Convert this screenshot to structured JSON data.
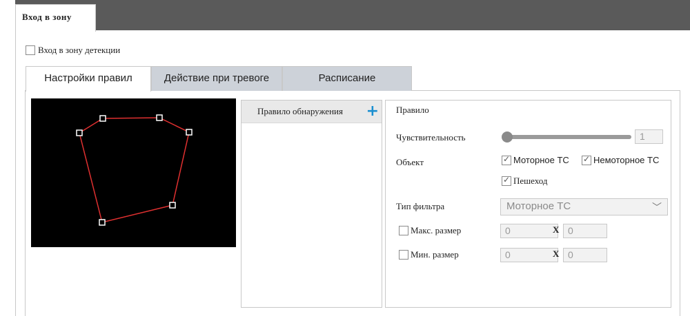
{
  "header": {
    "tab_title": "Вход в зону"
  },
  "enable": {
    "label": "Вход в зону детекции",
    "checked": false
  },
  "tabs": [
    {
      "label": "Настройки правил",
      "active": true
    },
    {
      "label": "Действие при тревоге",
      "active": false
    },
    {
      "label": "Расписание",
      "active": false
    }
  ],
  "rules_list": {
    "title": "Правило обнаружения"
  },
  "rule": {
    "title": "Правило",
    "sensitivity_label": "Чувствительность",
    "sensitivity_value": "1",
    "object_label": "Объект",
    "objects": [
      {
        "label": "Моторное ТС",
        "checked": true
      },
      {
        "label": "Немоторное ТС",
        "checked": true
      },
      {
        "label": "Пешеход",
        "checked": true
      }
    ],
    "filter_label": "Тип фильтра",
    "filter_value": "Моторное ТС",
    "max_size_label": "Макс. размер",
    "max_w": "0",
    "max_h": "0",
    "min_size_label": "Мин. размер",
    "min_w": "0",
    "min_h": "0",
    "x_sep": "X"
  },
  "colors": {
    "polygon": "#e03030",
    "accent": "#1a8fd0",
    "top_bar": "#5a5a5a"
  }
}
